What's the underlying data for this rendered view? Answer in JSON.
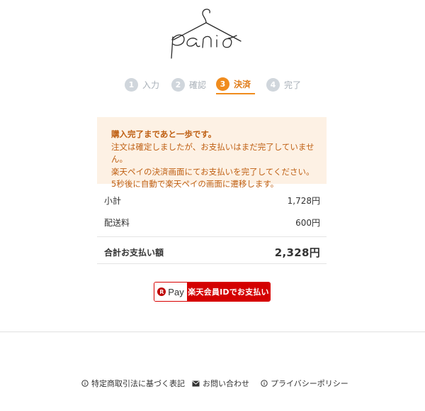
{
  "brand": {
    "logo_text": "panio"
  },
  "steps": [
    {
      "num": "1",
      "label": "入力",
      "state": "inactive"
    },
    {
      "num": "2",
      "label": "確認",
      "state": "inactive"
    },
    {
      "num": "3",
      "label": "決済",
      "state": "active"
    },
    {
      "num": "4",
      "label": "完了",
      "state": "inactive"
    }
  ],
  "notice": {
    "heading": "購入完了まであと一歩です。",
    "lines": [
      "注文は確定しましたが、お支払いはまだ完了していません。",
      "楽天ペイの決済画面にてお支払いを完了してください。",
      "5秒後に自動で楽天ペイの画面に遷移します。"
    ]
  },
  "summary": {
    "subtotal_label": "小計",
    "subtotal_value": "1,728円",
    "shipping_label": "配送料",
    "shipping_value": "600円",
    "total_label": "合計お支払い額",
    "total_value": "2,328円"
  },
  "payment_button": {
    "logo_mark": "R",
    "logo_text": "Pay",
    "label": "楽天会員IDでお支払い"
  },
  "footer": {
    "links": [
      {
        "label": "特定商取引法に基づく表記",
        "icon": "info-circle-icon"
      },
      {
        "label": "お問い合わせ",
        "icon": "envelope-icon"
      },
      {
        "label": "プライバシーポリシー",
        "icon": "info-circle-icon"
      }
    ]
  },
  "colors": {
    "accent": "#f08c1e",
    "notice_bg": "#fdf1e4",
    "notice_text": "#bf5f12",
    "rakuten_red": "#d40000",
    "step_inactive": "#d0d6dc"
  }
}
